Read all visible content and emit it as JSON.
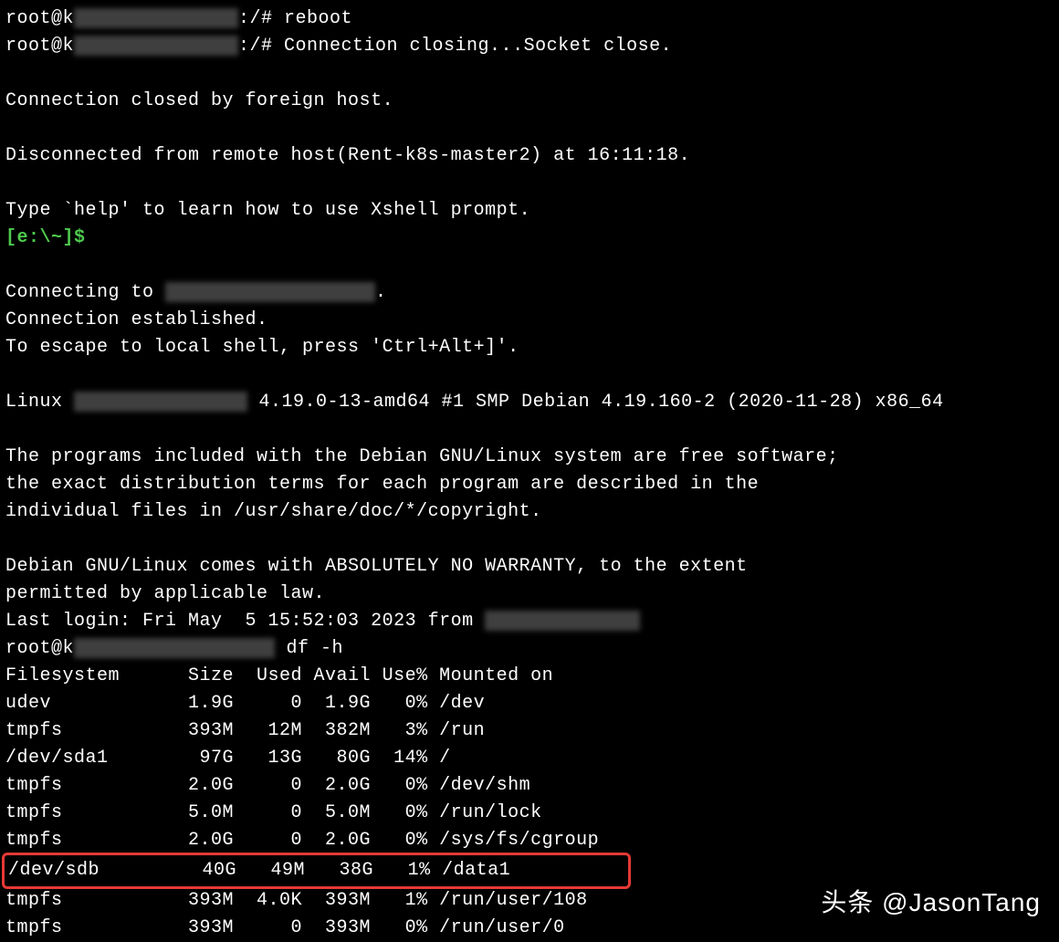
{
  "lines": {
    "l1_pre": "root@k",
    "l1_post": ":/# reboot",
    "l2_pre": "root@k",
    "l2_post": ":/# Connection closing...Socket close.",
    "l3": "",
    "l4": "Connection closed by foreign host.",
    "l5": "",
    "l6": "Disconnected from remote host(Rent-k8s-master2) at 16:11:18.",
    "l7": "",
    "l8": "Type `help' to learn how to use Xshell prompt.",
    "l9": "[e:\\~]$ ",
    "l10": "",
    "l11_pre": "Connecting to ",
    "l11_post": ".",
    "l12": "Connection established.",
    "l13": "To escape to local shell, press 'Ctrl+Alt+]'.",
    "l14": "",
    "l15_pre": "Linux ",
    "l15_post": " 4.19.0-13-amd64 #1 SMP Debian 4.19.160-2 (2020-11-28) x86_64",
    "l16": "",
    "l17": "The programs included with the Debian GNU/Linux system are free software;",
    "l18": "the exact distribution terms for each program are described in the",
    "l19": "individual files in /usr/share/doc/*/copyright.",
    "l20": "",
    "l21": "Debian GNU/Linux comes with ABSOLUTELY NO WARRANTY, to the extent",
    "l22": "permitted by applicable law.",
    "l23_pre": "Last login: Fri May  5 15:52:03 2023 from ",
    "l24_pre": "root@k",
    "l24_post": " df -h"
  },
  "df": {
    "header": "Filesystem      Size  Used Avail Use% Mounted on",
    "rows": [
      "udev            1.9G     0  1.9G   0% /dev",
      "tmpfs           393M   12M  382M   3% /run",
      "/dev/sda1        97G   13G   80G  14% /",
      "tmpfs           2.0G     0  2.0G   0% /dev/shm",
      "tmpfs           5.0M     0  5.0M   0% /run/lock",
      "tmpfs           2.0G     0  2.0G   0% /sys/fs/cgroup",
      "/dev/sdb         40G   49M   38G   1% /data1",
      "tmpfs           393M  4.0K  393M   1% /run/user/108",
      "tmpfs           393M     0  393M   0% /run/user/0"
    ]
  },
  "watermark": "头条 @JasonTang"
}
